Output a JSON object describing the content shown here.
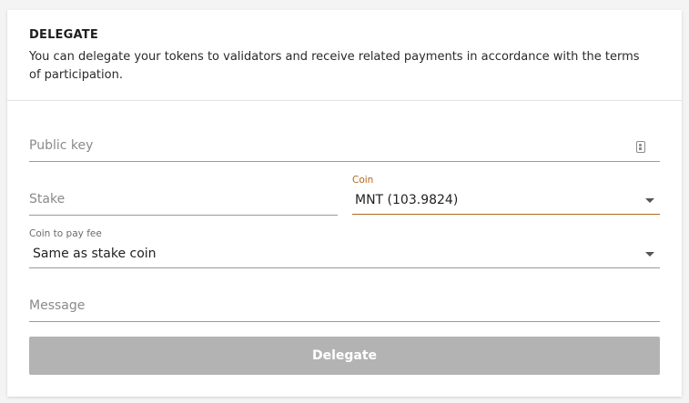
{
  "header": {
    "title": "DELEGATE",
    "description": "You can delegate your tokens to validators and receive related payments in accordance with the terms of participation."
  },
  "form": {
    "public_key": {
      "placeholder": "Public key",
      "icon": "key-icon"
    },
    "stake": {
      "placeholder": "Stake"
    },
    "coin": {
      "label": "Coin",
      "value": "MNT (103.9824)"
    },
    "fee_coin": {
      "label": "Coin to pay fee",
      "value": "Same as stake coin"
    },
    "message": {
      "placeholder": "Message"
    },
    "submit_label": "Delegate"
  },
  "colors": {
    "accent": "#b5651d",
    "button_disabled": "#b3b3b3"
  }
}
